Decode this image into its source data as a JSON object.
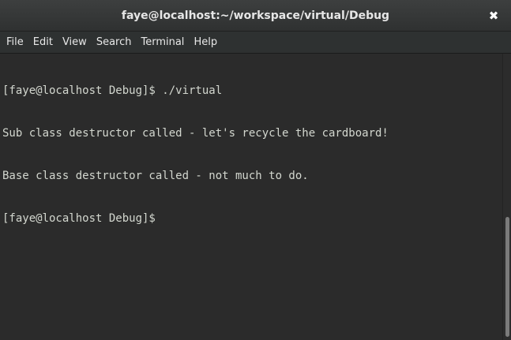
{
  "window": {
    "title": "faye@localhost:~/workspace/virtual/Debug",
    "close_glyph": "✖"
  },
  "menubar": {
    "items": [
      {
        "label": "File"
      },
      {
        "label": "Edit"
      },
      {
        "label": "View"
      },
      {
        "label": "Search"
      },
      {
        "label": "Terminal"
      },
      {
        "label": "Help"
      }
    ]
  },
  "terminal": {
    "lines": [
      "[faye@localhost Debug]$ ./virtual",
      "Sub class destructor called - let's recycle the cardboard!",
      "Base class destructor called - not much to do.",
      "[faye@localhost Debug]$ "
    ]
  },
  "colors": {
    "background": "#2b2b2b",
    "text": "#d3d7cf",
    "titlebar": "#3d3f3f"
  }
}
